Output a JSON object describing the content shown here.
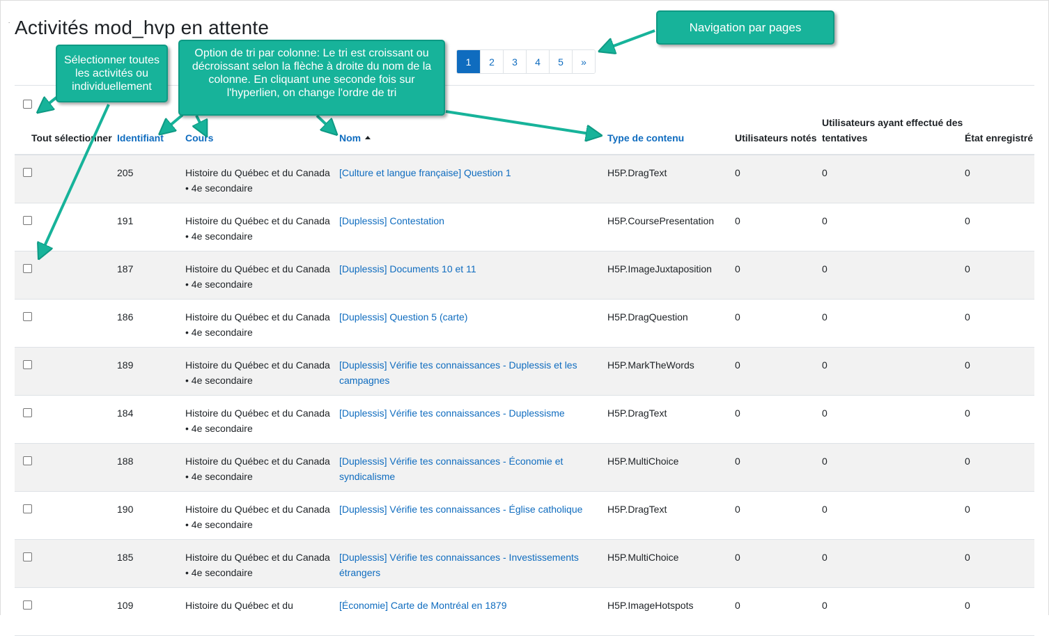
{
  "page": {
    "title": "Activités mod_hvp en attente",
    "dot": "."
  },
  "pagination": {
    "pages": [
      "1",
      "2",
      "3",
      "4",
      "5"
    ],
    "next": "»",
    "active": "1"
  },
  "table": {
    "headers": {
      "select_all": "Tout sélectionner",
      "id": "Identifiant",
      "course": "Cours",
      "name": "Nom",
      "type": "Type de contenu",
      "users": "Utilisateurs notés",
      "tries": "Utilisateurs ayant effectué des tentatives",
      "state": "État enregistré"
    },
    "rows": [
      {
        "id": "205",
        "course": "Histoire du Québec et du Canada • 4e secondaire",
        "name": "[Culture et langue française] Question 1",
        "type": "H5P.DragText",
        "users": "0",
        "tries": "0",
        "state": "0"
      },
      {
        "id": "191",
        "course": "Histoire du Québec et du Canada • 4e secondaire",
        "name": "[Duplessis] Contestation",
        "type": "H5P.CoursePresentation",
        "users": "0",
        "tries": "0",
        "state": "0"
      },
      {
        "id": "187",
        "course": "Histoire du Québec et du Canada • 4e secondaire",
        "name": "[Duplessis] Documents 10 et 11",
        "type": "H5P.ImageJuxtaposition",
        "users": "0",
        "tries": "0",
        "state": "0"
      },
      {
        "id": "186",
        "course": "Histoire du Québec et du Canada • 4e secondaire",
        "name": "[Duplessis] Question 5 (carte)",
        "type": "H5P.DragQuestion",
        "users": "0",
        "tries": "0",
        "state": "0"
      },
      {
        "id": "189",
        "course": "Histoire du Québec et du Canada • 4e secondaire",
        "name": "[Duplessis] Vérifie tes connaissances - Duplessis et les campagnes",
        "type": "H5P.MarkTheWords",
        "users": "0",
        "tries": "0",
        "state": "0"
      },
      {
        "id": "184",
        "course": "Histoire du Québec et du Canada • 4e secondaire",
        "name": "[Duplessis] Vérifie tes connaissances - Duplessisme",
        "type": "H5P.DragText",
        "users": "0",
        "tries": "0",
        "state": "0"
      },
      {
        "id": "188",
        "course": "Histoire du Québec et du Canada • 4e secondaire",
        "name": "[Duplessis] Vérifie tes connaissances - Économie et syndicalisme",
        "type": "H5P.MultiChoice",
        "users": "0",
        "tries": "0",
        "state": "0"
      },
      {
        "id": "190",
        "course": "Histoire du Québec et du Canada • 4e secondaire",
        "name": "[Duplessis] Vérifie tes connaissances - Église catholique",
        "type": "H5P.DragText",
        "users": "0",
        "tries": "0",
        "state": "0"
      },
      {
        "id": "185",
        "course": "Histoire du Québec et du Canada • 4e secondaire",
        "name": "[Duplessis] Vérifie tes connaissances - Investissements étrangers",
        "type": "H5P.MultiChoice",
        "users": "0",
        "tries": "0",
        "state": "0"
      },
      {
        "id": "109",
        "course": "Histoire du Québec et du",
        "name": "[Économie] Carte de Montréal en 1879",
        "type": "H5P.ImageHotspots",
        "users": "0",
        "tries": "0",
        "state": "0"
      }
    ]
  },
  "callouts": {
    "navigation": "Navigation par pages",
    "select": "Sélectionner toutes les activités ou individuellement",
    "sort": "Option de tri par colonne: Le tri est croissant ou décroissant selon la flèche à droite du nom de la colonne. En cliquant une seconde fois sur l'hyperlien, on change l'ordre de tri"
  },
  "colors": {
    "link": "#0f6cbf",
    "callout": "#17b39a",
    "row_alt": "#f2f2f2"
  }
}
